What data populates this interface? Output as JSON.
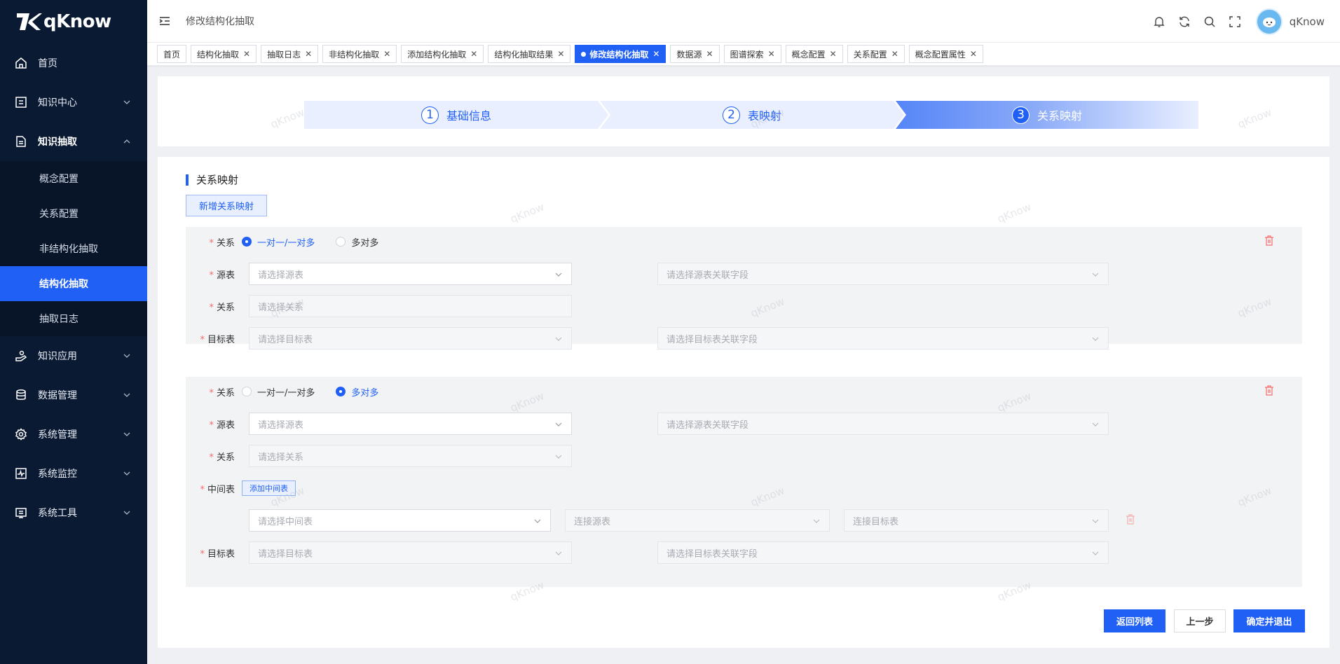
{
  "app": {
    "name": "qKnow"
  },
  "sidebar": {
    "home": "首页",
    "knowledge_center": "知识中心",
    "knowledge_extract": "知识抽取",
    "sub_items": [
      "概念配置",
      "关系配置",
      "非结构化抽取",
      "结构化抽取",
      "抽取日志"
    ],
    "knowledge_app": "知识应用",
    "data_mgmt": "数据管理",
    "system_mgmt": "系统管理",
    "system_monitor": "系统监控",
    "system_tools": "系统工具"
  },
  "header": {
    "breadcrumb": "修改结构化抽取",
    "username": "qKnow"
  },
  "tags": [
    {
      "label": "首页",
      "closable": false,
      "active": false
    },
    {
      "label": "结构化抽取",
      "closable": true,
      "active": false
    },
    {
      "label": "抽取日志",
      "closable": true,
      "active": false
    },
    {
      "label": "非结构化抽取",
      "closable": true,
      "active": false
    },
    {
      "label": "添加结构化抽取",
      "closable": true,
      "active": false
    },
    {
      "label": "结构化抽取结果",
      "closable": true,
      "active": false
    },
    {
      "label": "修改结构化抽取",
      "closable": true,
      "active": true
    },
    {
      "label": "数据源",
      "closable": true,
      "active": false
    },
    {
      "label": "图谱探索",
      "closable": true,
      "active": false
    },
    {
      "label": "概念配置",
      "closable": true,
      "active": false
    },
    {
      "label": "关系配置",
      "closable": true,
      "active": false
    },
    {
      "label": "概念配置属性",
      "closable": true,
      "active": false
    }
  ],
  "steps": [
    {
      "num": "1",
      "label": "基础信息"
    },
    {
      "num": "2",
      "label": "表映射"
    },
    {
      "num": "3",
      "label": "关系映射"
    }
  ],
  "section": {
    "title": "关系映射",
    "add_button": "新增关系映射"
  },
  "labels": {
    "relation": "关系",
    "source": "源表",
    "target": "目标表",
    "middle": "中间表"
  },
  "radio": {
    "one": "一对一/一对多",
    "many": "多对多"
  },
  "placeholders": {
    "source_table": "请选择源表",
    "source_field": "请选择源表关联字段",
    "relation": "请选择关系",
    "target_table": "请选择目标表",
    "target_field": "请选择目标表关联字段",
    "middle_table": "请选择中间表",
    "link_source": "连接源表",
    "link_target": "连接目标表"
  },
  "add_middle_button": "添加中间表",
  "footer": {
    "back": "返回列表",
    "prev": "上一步",
    "confirm": "确定并退出"
  },
  "watermark": "qKnow",
  "colors": {
    "primary": "#2160f5",
    "sidebar": "#0b1a33",
    "danger": "#f56c6c"
  }
}
